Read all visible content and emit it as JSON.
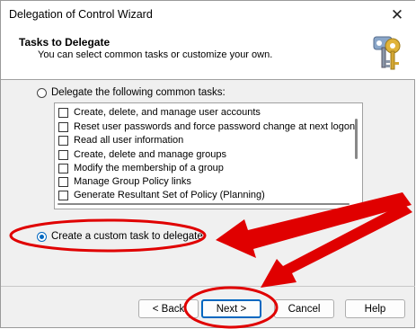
{
  "window": {
    "title": "Delegation of Control Wizard",
    "close_glyph": "✕"
  },
  "header": {
    "title": "Tasks to Delegate",
    "subtitle": "You can select common tasks or customize your own.",
    "icon": "keys-icon"
  },
  "options": {
    "common": {
      "label": "Delegate the following common tasks:",
      "selected": false
    },
    "custom": {
      "label": "Create a custom task to delegate",
      "selected": true
    }
  },
  "tasks": [
    {
      "label": "Create, delete, and manage user accounts",
      "checked": false
    },
    {
      "label": "Reset user passwords and force password change at next logon",
      "checked": false
    },
    {
      "label": "Read all user information",
      "checked": false
    },
    {
      "label": "Create, delete and manage groups",
      "checked": false
    },
    {
      "label": "Modify the membership of a group",
      "checked": false
    },
    {
      "label": "Manage Group Policy links",
      "checked": false
    },
    {
      "label": "Generate Resultant Set of Policy (Planning)",
      "checked": false
    }
  ],
  "buttons": {
    "back": "< Back",
    "next": "Next >",
    "cancel": "Cancel",
    "help": "Help"
  },
  "colors": {
    "annotation": "#e00000",
    "accent": "#0067c0"
  }
}
